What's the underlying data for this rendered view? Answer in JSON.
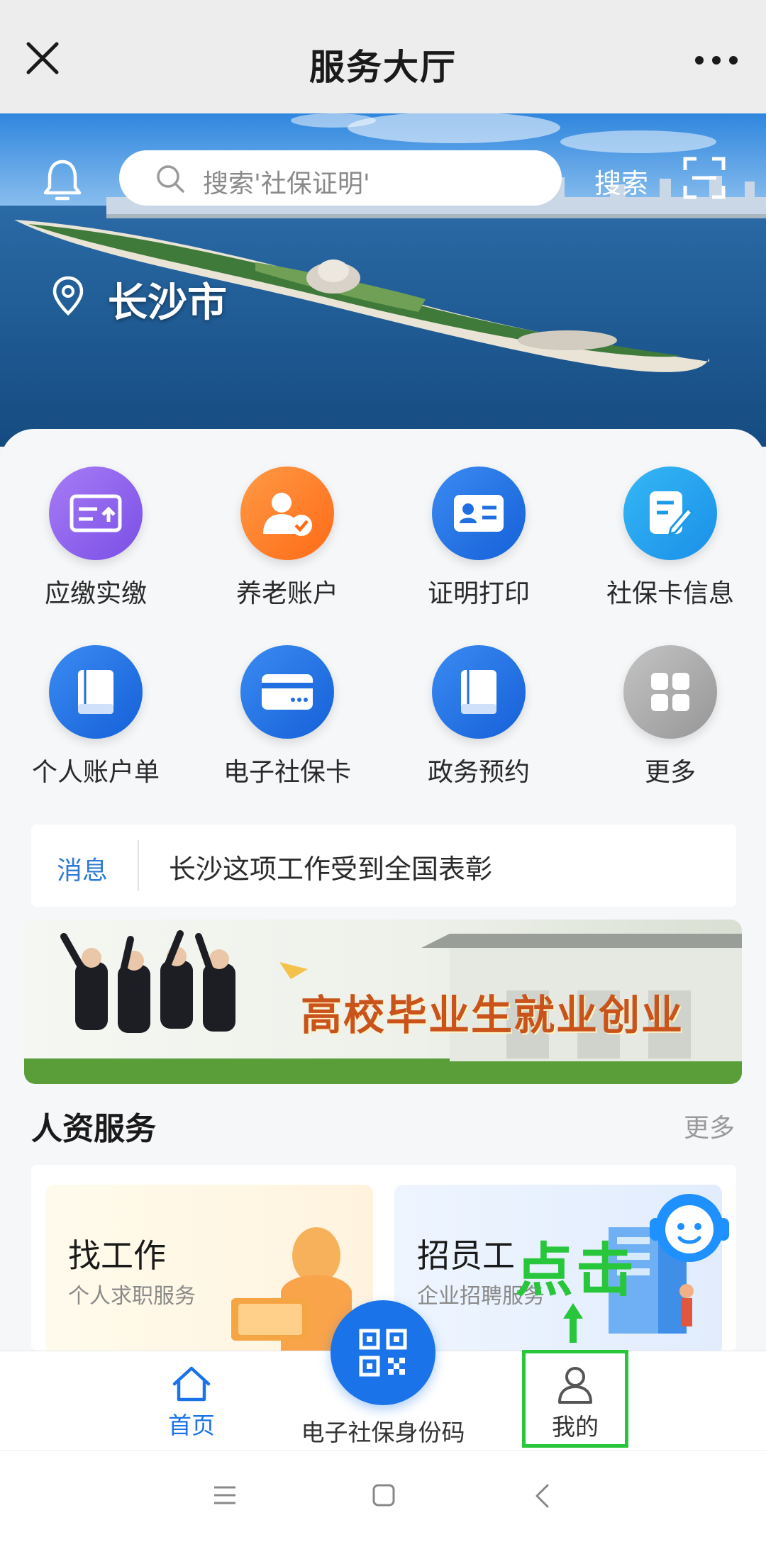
{
  "titlebar": {
    "title": "服务大厅"
  },
  "hero": {
    "search_placeholder": "搜索'社保证明'",
    "search_button": "搜索",
    "city": "长沙市"
  },
  "grid": [
    {
      "label": "应缴实缴",
      "icon": "payment-upload-icon",
      "color": "#8a5cf0"
    },
    {
      "label": "养老账户",
      "icon": "pension-user-check-icon",
      "color": "#ff7a1f"
    },
    {
      "label": "证明打印",
      "icon": "id-card-icon",
      "color": "#1f6fe0"
    },
    {
      "label": "社保卡信息",
      "icon": "edit-document-icon",
      "color": "#1aa3ef"
    },
    {
      "label": "个人账户单",
      "icon": "ledger-book-icon",
      "color": "#1f6fe0"
    },
    {
      "label": "电子社保卡",
      "icon": "credit-card-icon",
      "color": "#1f6fe0"
    },
    {
      "label": "政务预约",
      "icon": "book-icon",
      "color": "#1f6fe0"
    },
    {
      "label": "更多",
      "icon": "grid-more-icon",
      "color": "#a8a8a8"
    }
  ],
  "news": {
    "tag": "消息",
    "text": "长沙这项工作受到全国表彰"
  },
  "banner": {
    "text": "高校毕业生就业创业"
  },
  "section": {
    "title": "人资服务",
    "more": "更多"
  },
  "services": [
    {
      "title": "找工作",
      "subtitle": "个人求职服务"
    },
    {
      "title": "招员工",
      "subtitle": "企业招聘服务"
    }
  ],
  "annotation": {
    "text": "点击"
  },
  "tabs": {
    "home": "首页",
    "center": "电子社保身份码",
    "mine": "我的"
  },
  "colors": {
    "accent": "#1a73e8",
    "annotation": "#27c63b"
  }
}
